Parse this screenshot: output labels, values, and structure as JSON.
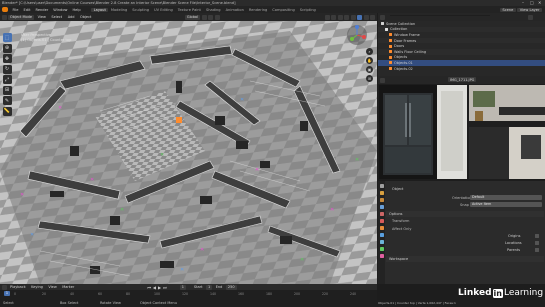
{
  "titlebar": {
    "title": "Blender* [C:\\Users\\user\\Documents\\Online Courses\\Blender 2.8 Create an Interior Scene\\Blender Scene File\\Interior_Scene.blend]",
    "controls": [
      "–",
      "□",
      "✕"
    ]
  },
  "menubar": {
    "menus": [
      "File",
      "Edit",
      "Render",
      "Window",
      "Help"
    ],
    "workspaces": [
      "Layout",
      "Modeling",
      "Sculpting",
      "UV Editing",
      "Texture Paint",
      "Shading",
      "Animation",
      "Rendering",
      "Compositing",
      "Scripting"
    ],
    "active_workspace": "Layout",
    "scene": "Scene",
    "view_layer": "View Layer"
  },
  "viewport_header": {
    "mode": "Object Mode",
    "view": "View",
    "select": "Select",
    "add": "Add",
    "object": "Object",
    "transform": "Global"
  },
  "viewport": {
    "view_name": "User Perspective",
    "collection": "(1) Objects.01 | Counter top"
  },
  "toolbar": {
    "tools": [
      "select-box",
      "cursor",
      "move",
      "rotate",
      "scale",
      "transform",
      "annotate",
      "measure"
    ]
  },
  "outliner": {
    "header": "Scene Collection",
    "rows": [
      {
        "label": "Scene Collection",
        "color": "#d0d0d0",
        "sel": false
      },
      {
        "label": "Collection",
        "color": "#e0e0e0",
        "sel": false
      },
      {
        "label": "Window Frame",
        "color": "#ff8c2e",
        "sel": false
      },
      {
        "label": "Door Frames",
        "color": "#ff8c2e",
        "sel": false
      },
      {
        "label": "Doors",
        "color": "#ff8c2e",
        "sel": false
      },
      {
        "label": "Walls Floor Ceiling",
        "color": "#ff8c2e",
        "sel": false
      },
      {
        "label": "Objects",
        "color": "#ff8c2e",
        "sel": false
      },
      {
        "label": "Objects.01",
        "color": "#ff8c2e",
        "sel": true
      },
      {
        "label": "Objects.02",
        "color": "#ff8c2e",
        "sel": false
      }
    ]
  },
  "properties": {
    "tab_label": "IMG_1711.JPG",
    "panel_title": "Object",
    "orientation_label": "Orientation",
    "orientation_value": "Default",
    "snap_label": "Snap",
    "snap_value": "Active Item",
    "sections": [
      "Options",
      "Transform",
      "Affect Only",
      "Workspace"
    ],
    "checks": [
      "Origins",
      "Locations",
      "Parents"
    ]
  },
  "timeline": {
    "playback": "Playback",
    "keying": "Keying",
    "view": "View",
    "marker": "Marker",
    "frame": "1",
    "start_label": "Start",
    "start": "1",
    "end_label": "End",
    "end": "250",
    "ticks": [
      "0",
      "20",
      "40",
      "60",
      "80",
      "100",
      "120",
      "140",
      "160",
      "180",
      "200",
      "220",
      "240"
    ]
  },
  "statusbar": {
    "left": "Select",
    "mid1": "Box Select",
    "mid2": "Rotate View",
    "mid3": "Object Context Menu",
    "right": "Objects.01 | Counter top | Verts:1,062,447 | Faces:1,038,116 | Tris:2,074,402 | Objects:1/489 | Mem:800 MB | v2.80.75"
  },
  "watermark": {
    "brand_left": "Linked",
    "brand_in": "in",
    "brand_right": " Learning"
  },
  "colors": {
    "accent": "#4772b3",
    "collection": "#ff8c2e"
  }
}
